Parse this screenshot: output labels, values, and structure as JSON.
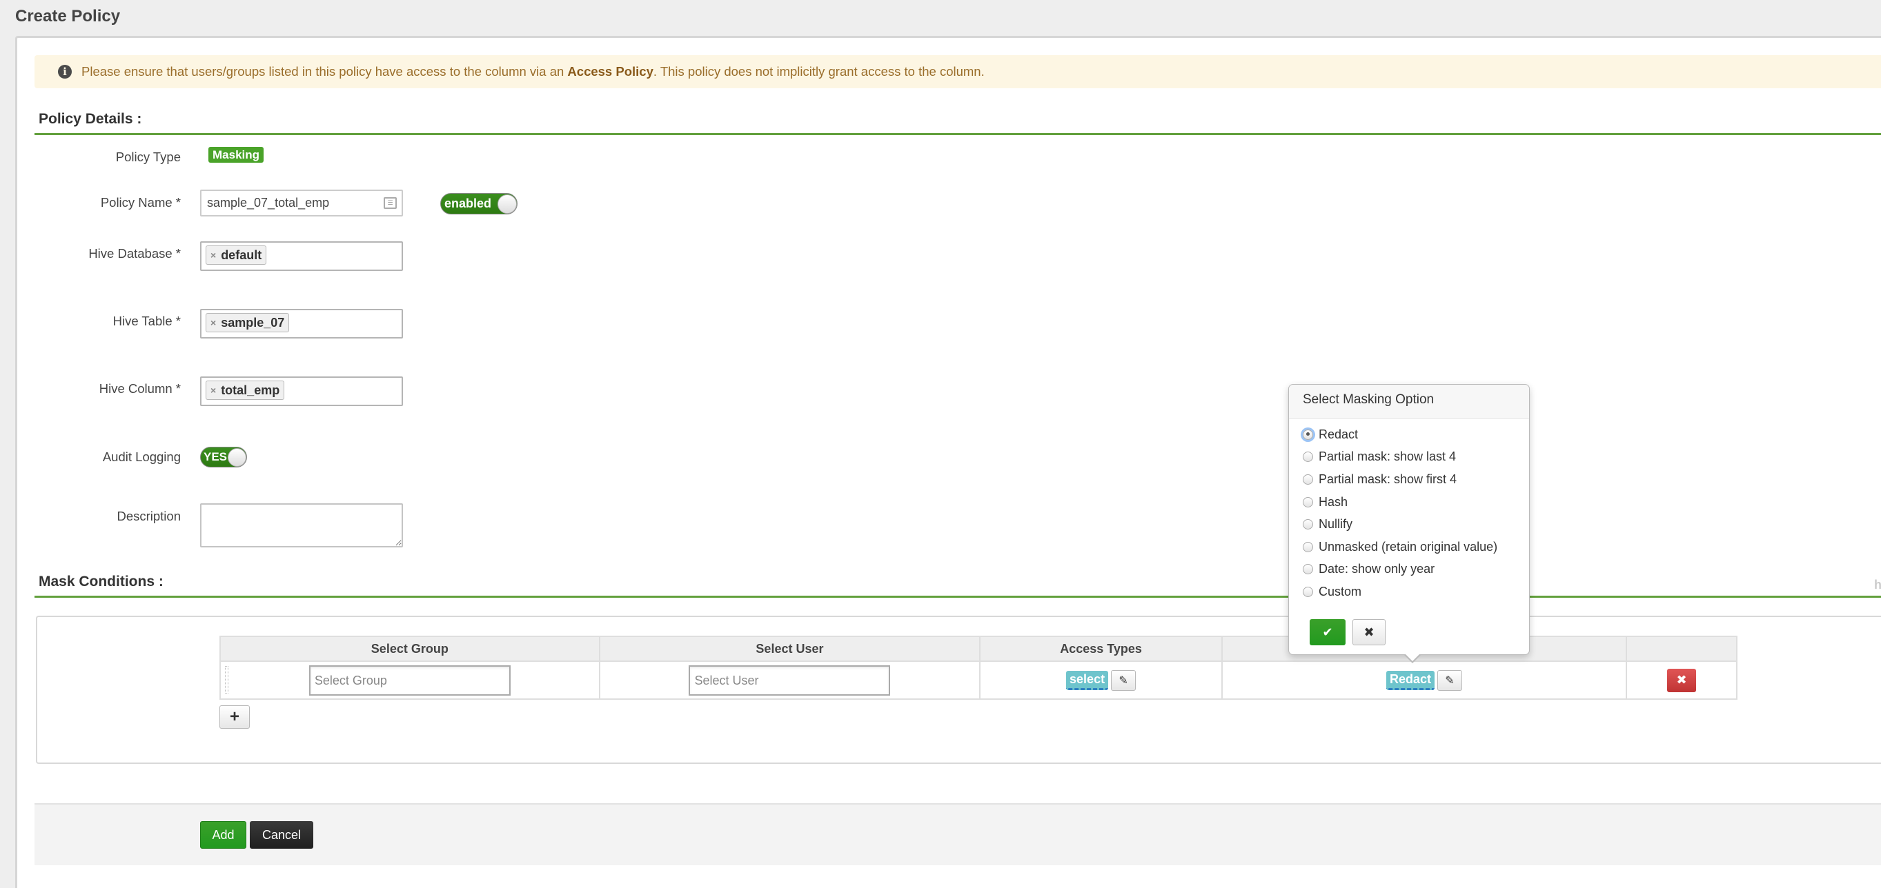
{
  "page": {
    "title": "Create Policy"
  },
  "alert": {
    "icon": "info-icon",
    "text_before": "Please ensure that users/groups listed in this policy have access to the column via an ",
    "bold": "Access Policy",
    "text_after": ". This policy does not implicitly grant access to the column."
  },
  "policy_details": {
    "section_title": "Policy Details :",
    "policy_type": {
      "label": "Policy Type",
      "value": "Masking"
    },
    "policy_name": {
      "label": "Policy Name *",
      "value": "sample_07_total_emp",
      "toggle_label": "enabled"
    },
    "hive_database": {
      "label": "Hive Database *",
      "tag": "default"
    },
    "hive_table": {
      "label": "Hive Table *",
      "tag": "sample_07"
    },
    "hive_column": {
      "label": "Hive Column *",
      "tag": "total_emp"
    },
    "audit_logging": {
      "label": "Audit Logging",
      "toggle_label": "YES"
    },
    "description": {
      "label": "Description",
      "value": ""
    }
  },
  "mask_conditions": {
    "section_title": "Mask Conditions :",
    "hide_link_partial": "h",
    "columns": [
      "Select Group",
      "Select User",
      "Access Types",
      "",
      ""
    ],
    "rows": [
      {
        "group_placeholder": "Select Group",
        "user_placeholder": "Select User",
        "access_type": "select",
        "masking": "Redact"
      }
    ],
    "add_row_label": "+"
  },
  "masking_popover": {
    "title": "Select Masking Option",
    "options": [
      {
        "label": "Redact",
        "checked": true
      },
      {
        "label": "Partial mask: show last 4",
        "checked": false
      },
      {
        "label": "Partial mask: show first 4",
        "checked": false
      },
      {
        "label": "Hash",
        "checked": false
      },
      {
        "label": "Nullify",
        "checked": false
      },
      {
        "label": "Unmasked (retain original value)",
        "checked": false
      },
      {
        "label": "Date: show only year",
        "checked": false
      },
      {
        "label": "Custom",
        "checked": false
      }
    ],
    "ok_icon": "✔",
    "cancel_icon": "✖"
  },
  "footer": {
    "add_label": "Add",
    "cancel_label": "Cancel"
  },
  "colors": {
    "accent_green": "#62a03c",
    "alert_bg": "#fdf6e3",
    "tag_teal": "#6ec4cc",
    "danger": "#d04444"
  }
}
